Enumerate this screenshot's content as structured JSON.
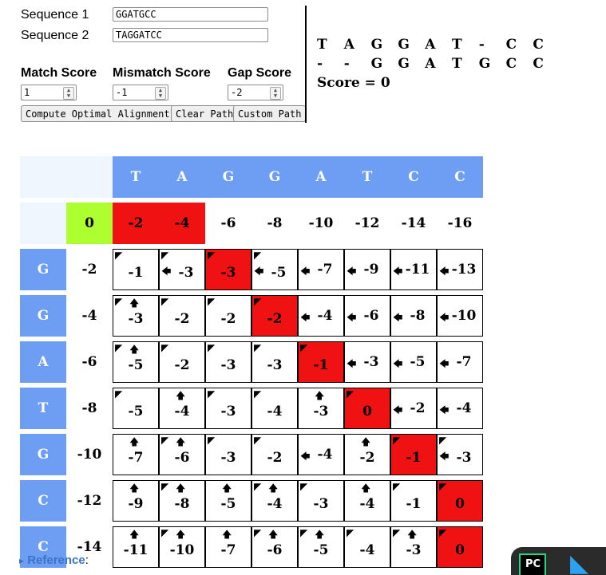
{
  "form": {
    "seq1_label": "Sequence 1",
    "seq1_value": "GGATGCC",
    "seq2_label": "Sequence 2",
    "seq2_value": "TAGGATCC",
    "match_label": "Match Score",
    "match_value": "1",
    "mismatch_label": "Mismatch Score",
    "mismatch_value": "-1",
    "gap_label": "Gap Score",
    "gap_value": "-2",
    "compute_label": "Compute Optimal Alignment",
    "clear_label": "Clear Path",
    "custom_label": "Custom Path"
  },
  "alignment": {
    "top": [
      "T",
      "A",
      "G",
      "G",
      "A",
      "T",
      "-",
      "C",
      "C"
    ],
    "bottom": [
      "-",
      "-",
      "G",
      "G",
      "A",
      "T",
      "G",
      "C",
      "C"
    ],
    "score_text": "Score = 0"
  },
  "matrix": {
    "col_headers": [
      "T",
      "A",
      "G",
      "G",
      "A",
      "T",
      "C",
      "C"
    ],
    "row_headers": [
      "G",
      "G",
      "A",
      "T",
      "G",
      "C",
      "C"
    ],
    "first_row": [
      "0",
      "-2",
      "-4",
      "-6",
      "-8",
      "-10",
      "-12",
      "-14",
      "-16"
    ],
    "first_col": [
      "-2",
      "-4",
      "-6",
      "-8",
      "-10",
      "-12",
      "-14"
    ],
    "cells": [
      [
        "-1",
        "-3",
        "-3",
        "-5",
        "-7",
        "-9",
        "-11",
        "-13"
      ],
      [
        "-3",
        "-2",
        "-2",
        "-2",
        "-4",
        "-6",
        "-8",
        "-10"
      ],
      [
        "-5",
        "-2",
        "-3",
        "-3",
        "-1",
        "-3",
        "-5",
        "-7"
      ],
      [
        "-5",
        "-4",
        "-3",
        "-4",
        "-3",
        "0",
        "-2",
        "-4"
      ],
      [
        "-7",
        "-6",
        "-3",
        "-2",
        "-4",
        "-2",
        "-1",
        "-3"
      ],
      [
        "-9",
        "-8",
        "-5",
        "-4",
        "-3",
        "-4",
        "-1",
        "0"
      ],
      [
        "-11",
        "-10",
        "-7",
        "-6",
        "-5",
        "-4",
        "-3",
        "0"
      ]
    ],
    "arrows": [
      [
        "d",
        "dl",
        "d",
        "dl",
        "l",
        "l",
        "l",
        "l"
      ],
      [
        "du",
        "d",
        "d",
        "d",
        "l",
        "l",
        "l",
        "l"
      ],
      [
        "du",
        "d",
        "d",
        "d",
        "d",
        "l",
        "l",
        "l"
      ],
      [
        "d",
        "u",
        "d",
        "d",
        "u",
        "d",
        "l",
        "l"
      ],
      [
        "u",
        "du",
        "d",
        "d",
        "l",
        "u",
        "d",
        "dl"
      ],
      [
        "u",
        "du",
        "u",
        "du",
        "d",
        "u",
        "d",
        "d"
      ],
      [
        "u",
        "du",
        "u",
        "du",
        "du",
        "d",
        "du",
        "d"
      ]
    ],
    "path": [
      [
        0,
        0
      ],
      [
        0,
        1
      ],
      [
        0,
        2
      ],
      [
        1,
        3
      ],
      [
        2,
        4
      ],
      [
        3,
        5
      ],
      [
        4,
        6
      ],
      [
        5,
        7
      ],
      [
        6,
        8
      ],
      [
        7,
        8
      ]
    ],
    "path_color": "#f01212",
    "start_color": "#adff2f",
    "header_color": "#6e9ef3"
  },
  "reference": {
    "marker": "▸",
    "label": "Reference",
    "suffix": ":"
  },
  "dock": {
    "pc_label": "PC",
    "vs_glyph": "◣"
  }
}
